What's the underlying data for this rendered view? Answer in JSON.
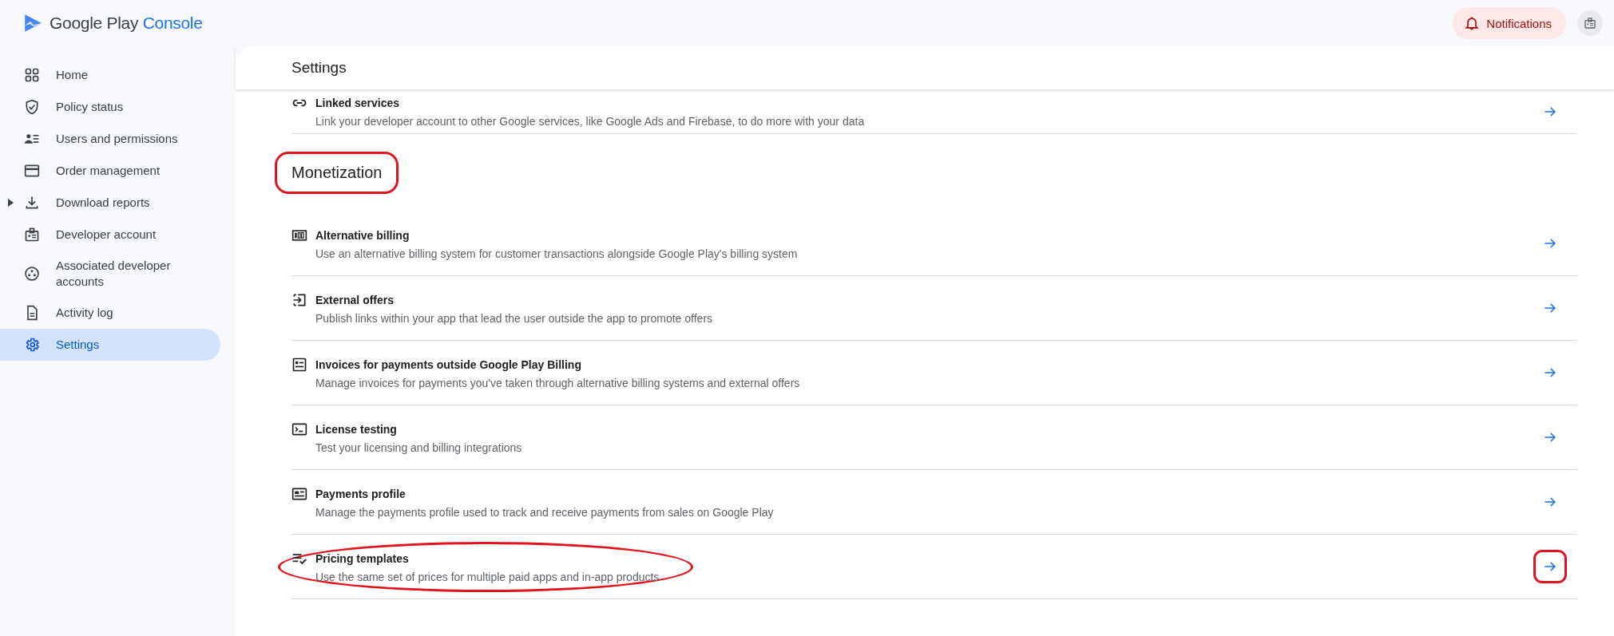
{
  "header": {
    "logo": {
      "word1": "Google Play",
      "word2": "Console"
    },
    "notifications": "Notifications"
  },
  "sidebar": {
    "items": [
      {
        "label": "Home",
        "kind": "grid",
        "selected": false,
        "expandable": false
      },
      {
        "label": "Policy status",
        "kind": "shield",
        "selected": false,
        "expandable": false
      },
      {
        "label": "Users and permissions",
        "kind": "users",
        "selected": false,
        "expandable": false
      },
      {
        "label": "Order management",
        "kind": "card",
        "selected": false,
        "expandable": false
      },
      {
        "label": "Download reports",
        "kind": "download",
        "selected": false,
        "expandable": true
      },
      {
        "label": "Developer account",
        "kind": "badge",
        "selected": false,
        "expandable": false
      },
      {
        "label": "Associated developer accounts",
        "kind": "circles",
        "selected": false,
        "expandable": false
      },
      {
        "label": "Activity log",
        "kind": "doc",
        "selected": false,
        "expandable": false
      },
      {
        "label": "Settings",
        "kind": "gear",
        "selected": true,
        "expandable": false
      }
    ]
  },
  "page": {
    "title": "Settings",
    "linked_row": {
      "kind": "link",
      "title": "Linked services",
      "description": "Link your developer account to other Google services, like Google Ads and Firebase, to do more with your data"
    },
    "section": {
      "heading": "Monetization",
      "highlighted": true,
      "rows": [
        {
          "kind": "billing",
          "title": "Alternative billing",
          "description": "Use an alternative billing system for customer transactions alongside Google Play's billing system",
          "highlighted": false
        },
        {
          "kind": "exit",
          "title": "External offers",
          "description": "Publish links within your app that lead the user outside the app to promote offers",
          "highlighted": false
        },
        {
          "kind": "invoice",
          "title": "Invoices for payments outside Google Play Billing",
          "description": "Manage invoices for payments you've taken through alternative billing systems and external offers",
          "highlighted": false
        },
        {
          "kind": "terminal",
          "title": "License testing",
          "description": "Test your licensing and billing integrations",
          "highlighted": false
        },
        {
          "kind": "payment",
          "title": "Payments profile",
          "description": "Manage the payments profile used to track and receive payments from sales on Google Play",
          "highlighted": false
        },
        {
          "kind": "checklist",
          "title": "Pricing templates",
          "description": "Use the same set of prices for multiple paid apps and in-app products",
          "highlighted": true
        }
      ]
    }
  }
}
